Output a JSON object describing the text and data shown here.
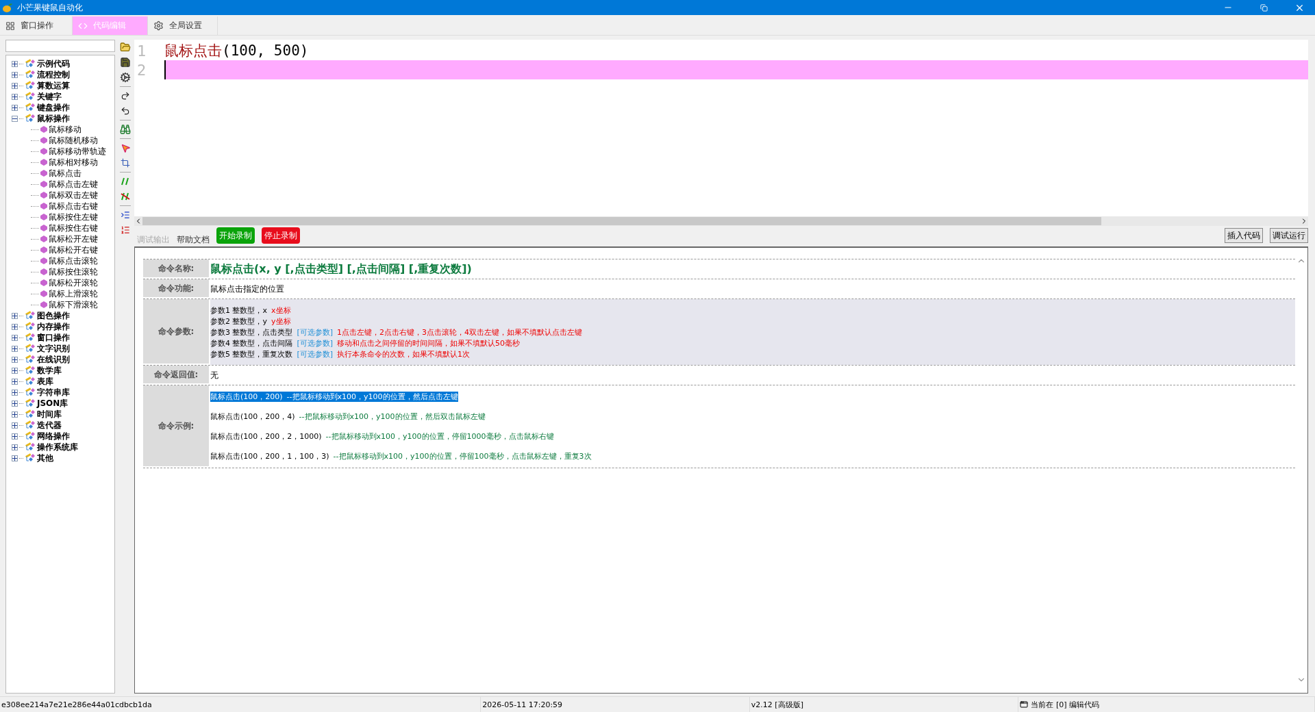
{
  "window": {
    "title": "小芒果键鼠自动化"
  },
  "tabs": [
    {
      "label": "窗口操作",
      "selected": false
    },
    {
      "label": "代码编辑",
      "selected": true
    },
    {
      "label": "全局设置",
      "selected": false
    }
  ],
  "sidebar": {
    "tree": [
      {
        "label": "示例代码",
        "expanded": false
      },
      {
        "label": "流程控制",
        "expanded": false
      },
      {
        "label": "算数运算",
        "expanded": false
      },
      {
        "label": "关键字",
        "expanded": false
      },
      {
        "label": "键盘操作",
        "expanded": false
      },
      {
        "label": "鼠标操作",
        "expanded": true,
        "children": [
          {
            "label": "鼠标移动"
          },
          {
            "label": "鼠标随机移动"
          },
          {
            "label": "鼠标移动带轨迹"
          },
          {
            "label": "鼠标相对移动"
          },
          {
            "label": "鼠标点击"
          },
          {
            "label": "鼠标点击左键"
          },
          {
            "label": "鼠标双击左键"
          },
          {
            "label": "鼠标点击右键"
          },
          {
            "label": "鼠标按住左键"
          },
          {
            "label": "鼠标按住右键"
          },
          {
            "label": "鼠标松开左键"
          },
          {
            "label": "鼠标松开右键"
          },
          {
            "label": "鼠标点击滚轮"
          },
          {
            "label": "鼠标按住滚轮"
          },
          {
            "label": "鼠标松开滚轮"
          },
          {
            "label": "鼠标上滑滚轮"
          },
          {
            "label": "鼠标下滑滚轮"
          }
        ]
      },
      {
        "label": "图色操作",
        "expanded": false
      },
      {
        "label": "内存操作",
        "expanded": false
      },
      {
        "label": "窗口操作",
        "expanded": false
      },
      {
        "label": "文字识别",
        "expanded": false
      },
      {
        "label": "在线识别",
        "expanded": false
      },
      {
        "label": "数学库",
        "expanded": false
      },
      {
        "label": "表库",
        "expanded": false
      },
      {
        "label": "字符串库",
        "expanded": false
      },
      {
        "label": "JSON库",
        "expanded": false
      },
      {
        "label": "时间库",
        "expanded": false
      },
      {
        "label": "迭代器",
        "expanded": false
      },
      {
        "label": "网络操作",
        "expanded": false
      },
      {
        "label": "操作系统库",
        "expanded": false
      },
      {
        "label": "其他",
        "expanded": false
      }
    ]
  },
  "editor": {
    "lines": [
      {
        "number": "1",
        "current": false,
        "tokens": [
          {
            "kind": "function",
            "text": "鼠标点击"
          },
          {
            "kind": "plain",
            "text": "(100, 500)"
          }
        ]
      },
      {
        "number": "2",
        "current": true
      }
    ]
  },
  "output_tabs": [
    {
      "label": "调试输出",
      "selected": false
    },
    {
      "label": "帮助文档",
      "selected": true
    }
  ],
  "record_buttons": [
    {
      "label": "开始录制",
      "kind": "start"
    },
    {
      "label": "停止录制",
      "kind": "stop"
    }
  ],
  "actions": [
    "插入代码",
    "调试运行"
  ],
  "help": {
    "rows": [
      {
        "label": "命令名称:",
        "kind": "title",
        "text": "鼠标点击(x, y [,点击类型] [,点击间隔] [,重复次数])"
      },
      {
        "label": "命令功能:",
        "kind": "text",
        "text": "鼠标点击指定的位置"
      },
      {
        "label": "命令参数:",
        "kind": "params",
        "params": [
          {
            "head": "参数1 整数型，x",
            "desc": "x坐标"
          },
          {
            "head": "参数2 整数型，y",
            "desc": "y坐标"
          },
          {
            "head": "参数3 整数型，点击类型",
            "tag": "[可选参数]",
            "desc": "1点击左键，2点击右键，3点击滚轮，4双击左键，如果不填默认点击左键"
          },
          {
            "head": "参数4 整数型，点击间隔",
            "tag": "[可选参数]",
            "desc": "移动和点击之间停留的时间间隔，如果不填默认50毫秒"
          },
          {
            "head": "参数5 整数型，重复次数",
            "tag": "[可选参数]",
            "desc": "执行本条命令的次数，如果不填默认1次"
          }
        ]
      },
      {
        "label": "命令返回值:",
        "kind": "text",
        "text": "无"
      },
      {
        "label": "命令示例:",
        "kind": "examples",
        "examples": [
          {
            "code": "鼠标点击(100，200)",
            "comment": "--把鼠标移动到x100，y100的位置，然后点击左键",
            "selected": true
          },
          {
            "code": "鼠标点击(100，200，4)",
            "comment": "--把鼠标移动到x100，y100的位置，然后双击鼠标左键",
            "selected": false
          },
          {
            "code": "鼠标点击(100，200，2，1000)",
            "comment": "--把鼠标移动到x100，y100的位置，停留1000毫秒，点击鼠标右键",
            "selected": false
          },
          {
            "code": "鼠标点击(100，200，1，100，3)",
            "comment": "--把鼠标移动到x100，y100的位置，停留100毫秒，点击鼠标左键，重复3次",
            "selected": false
          }
        ]
      }
    ]
  },
  "status_bar": [
    {
      "text": "e308ee214a7e21e286e44a01cdbcb1da"
    },
    {
      "text": "2026-05-11 17:20:59"
    },
    {
      "text": "v2.12 [高级版]"
    },
    {
      "text": "当前在 [0] 编辑代码"
    }
  ]
}
